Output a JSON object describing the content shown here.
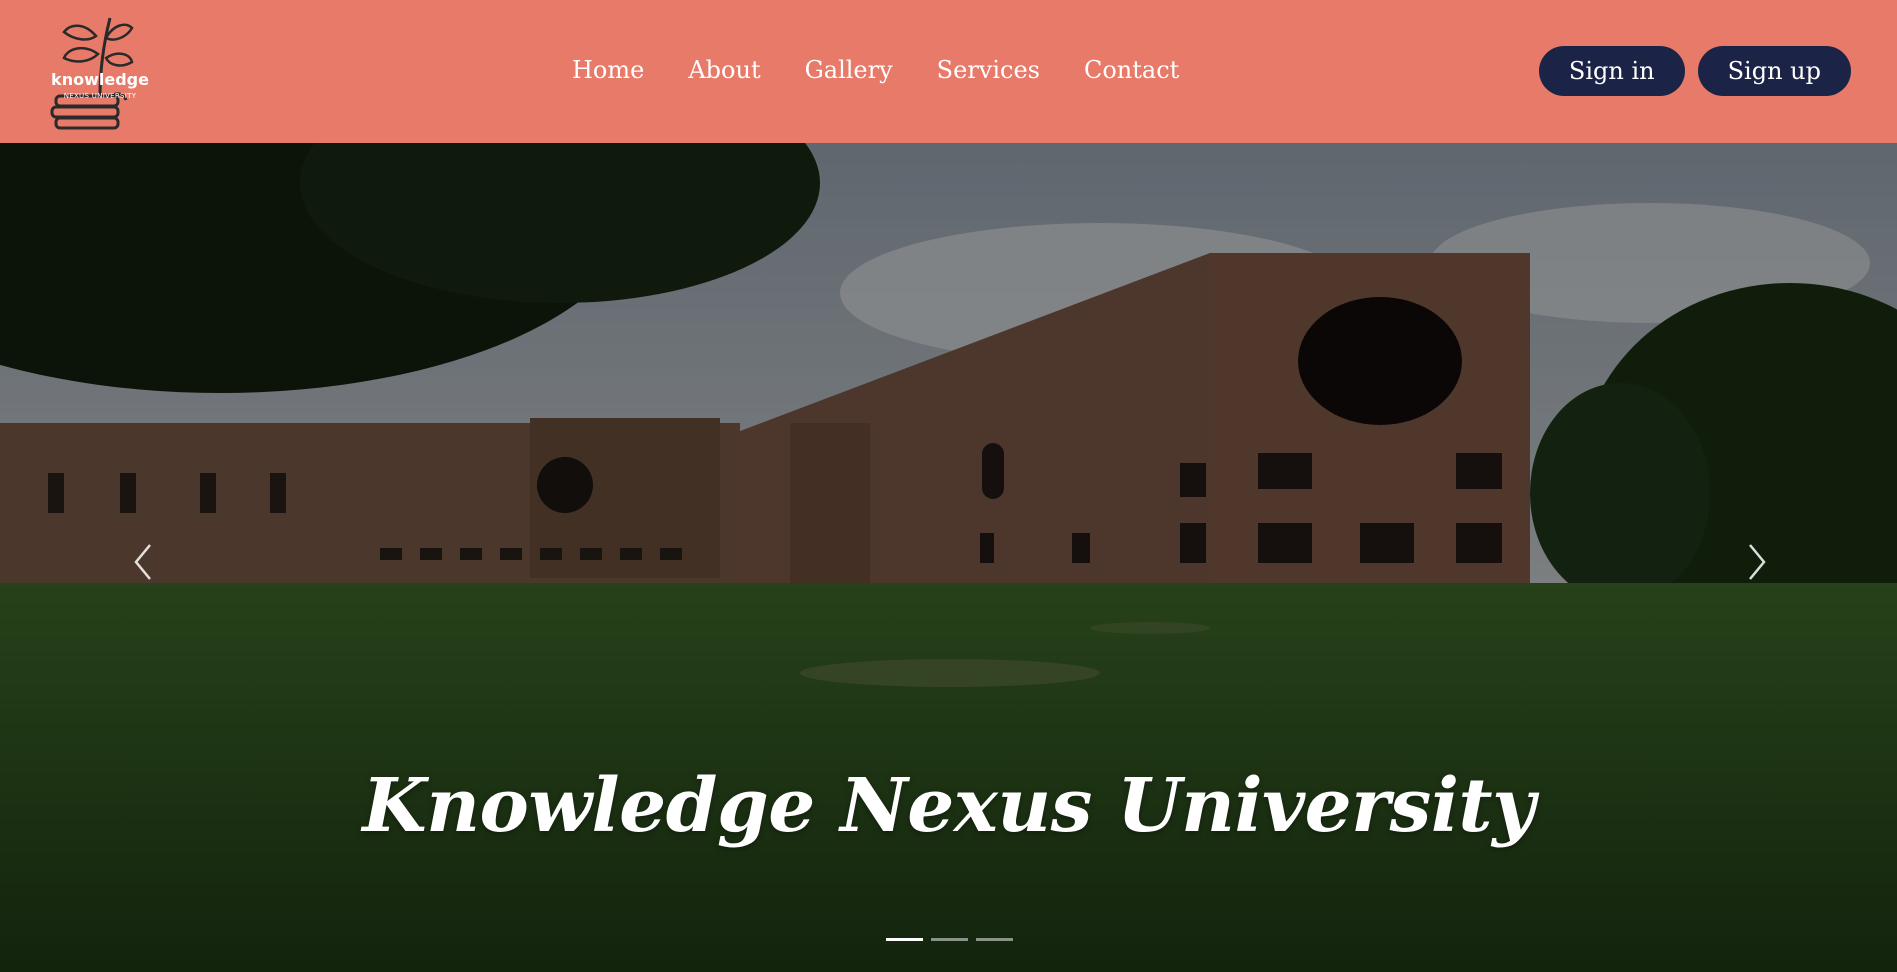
{
  "brand": {
    "logo_word": "knowledge",
    "logo_sub": "NEXUS UNIVERSITY"
  },
  "nav": {
    "items": [
      {
        "label": "Home"
      },
      {
        "label": "About"
      },
      {
        "label": "Gallery"
      },
      {
        "label": "Services"
      },
      {
        "label": "Contact"
      }
    ]
  },
  "auth": {
    "sign_in_label": "Sign in",
    "sign_up_label": "Sign up"
  },
  "hero": {
    "title": "Knowledge Nexus University",
    "slide_count": 3,
    "active_slide": 1,
    "prev_icon": "chevron-left-icon",
    "next_icon": "chevron-right-icon"
  },
  "colors": {
    "header_bg": "#e87a6a",
    "button_bg": "#1b2346",
    "text": "#ffffff"
  }
}
